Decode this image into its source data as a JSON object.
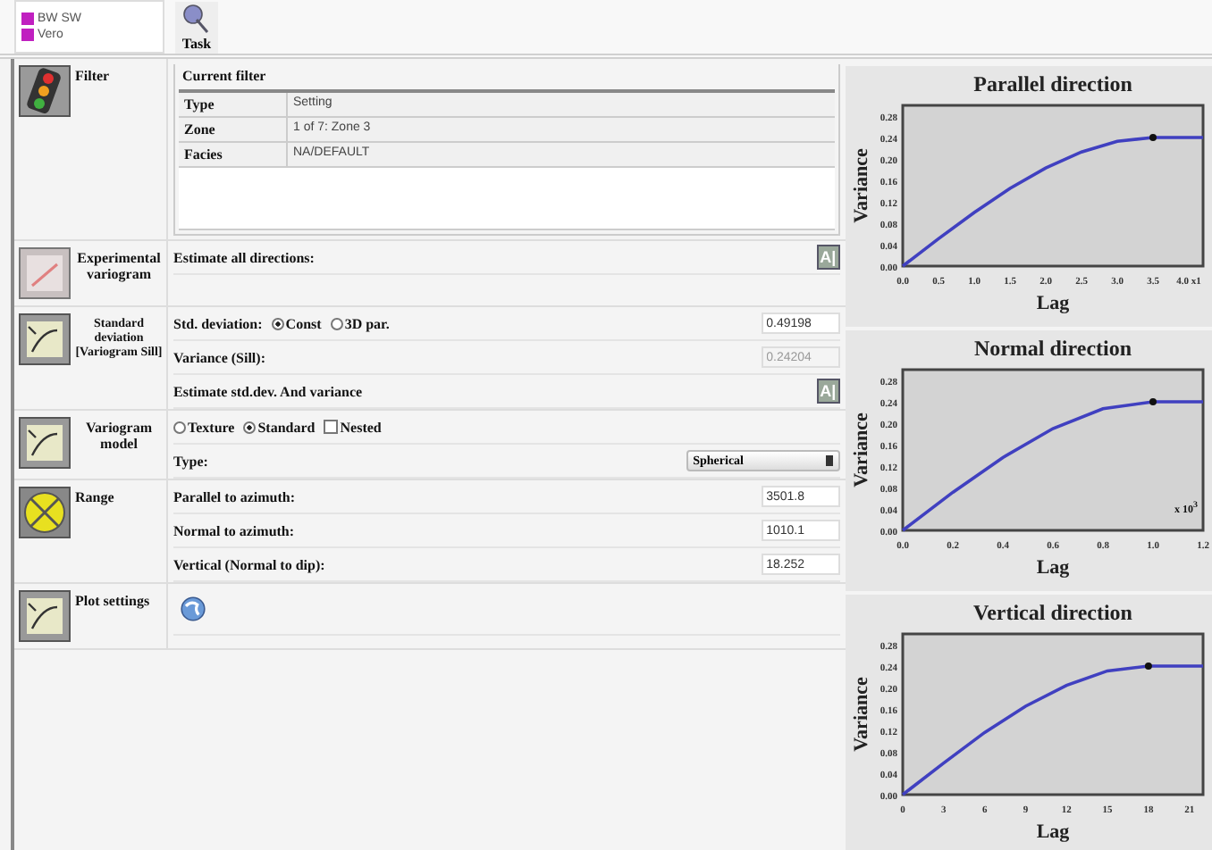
{
  "legend": [
    {
      "label": "BW SW",
      "color": "#c020c0"
    },
    {
      "label": "Vero",
      "color": "#c020c0"
    }
  ],
  "task_button": {
    "label": "Task"
  },
  "filter": {
    "label": "Filter",
    "group_title": "Current filter",
    "rows": [
      {
        "key": "Type",
        "value": "Setting"
      },
      {
        "key": "Zone",
        "value": "1 of 7: Zone 3"
      },
      {
        "key": "Facies",
        "value": "NA/DEFAULT"
      }
    ]
  },
  "experimental_variogram": {
    "label": "Experimental variogram",
    "text": "Estimate all directions:",
    "button": "A|"
  },
  "standard_deviation": {
    "label": "Standard deviation [Variogram Sill]",
    "std_label": "Std. deviation:",
    "options": [
      {
        "label": "Const",
        "selected": true
      },
      {
        "label": "3D par.",
        "selected": false
      }
    ],
    "std_value": "0.49198",
    "variance_label": "Variance (Sill):",
    "variance_value": "0.24204",
    "variance_disabled": true,
    "estimate_text": "Estimate std.dev. And variance",
    "button": "A|"
  },
  "variogram_model": {
    "label": "Variogram model",
    "options": [
      {
        "kind": "radio",
        "label": "Texture",
        "selected": false
      },
      {
        "kind": "radio",
        "label": "Standard",
        "selected": true
      },
      {
        "kind": "checkbox",
        "label": "Nested",
        "checked": false
      }
    ],
    "type_label": "Type:",
    "type_value": "Spherical"
  },
  "range": {
    "label": "Range",
    "rows": [
      {
        "label": "Parallel to azimuth:",
        "value": "3501.8"
      },
      {
        "label": "Normal to azimuth:",
        "value": "1010.1"
      },
      {
        "label": "Vertical (Normal to dip):",
        "value": "18.252"
      }
    ]
  },
  "plot_settings": {
    "label": "Plot settings"
  },
  "charts": [
    {
      "chart_data": {
        "type": "line",
        "title": "Parallel direction",
        "xlabel": "Lag",
        "ylabel": "Variance",
        "x": [
          0,
          0.5,
          1.0,
          1.5,
          2.0,
          2.5,
          3.0,
          3.5,
          4.0,
          4.2
        ],
        "series": [
          {
            "color": "#4040c0",
            "values": [
              0,
              0.051,
              0.1,
              0.145,
              0.183,
              0.213,
              0.233,
              0.24,
              0.24,
              0.24
            ]
          }
        ],
        "xlim": [
          0,
          4.2
        ],
        "ylim": [
          0,
          0.3
        ],
        "xticks": [
          {
            "value": 0,
            "label": "0.0"
          },
          {
            "value": 0.5,
            "label": "0.5"
          },
          {
            "value": 1,
            "label": "1.0"
          },
          {
            "value": 1.5,
            "label": "1.5"
          },
          {
            "value": 2,
            "label": "2.0"
          },
          {
            "value": 2.5,
            "label": "2.5"
          },
          {
            "value": 3,
            "label": "3.0"
          },
          {
            "value": 3.5,
            "label": "3.5"
          },
          {
            "value": 4,
            "label": "4.0 x1"
          }
        ],
        "yticks": [
          {
            "value": 0,
            "label": "0.00"
          },
          {
            "value": 0.04,
            "label": "0.04"
          },
          {
            "value": 0.08,
            "label": "0.08"
          },
          {
            "value": 0.12,
            "label": "0.12"
          },
          {
            "value": 0.16,
            "label": "0.16"
          },
          {
            "value": 0.2,
            "label": "0.20"
          },
          {
            "value": 0.24,
            "label": "0.24"
          },
          {
            "value": 0.28,
            "label": "0.28"
          }
        ]
      }
    },
    {
      "chart_data": {
        "type": "line",
        "title": "Normal direction",
        "xlabel": "Lag",
        "ylabel": "Variance",
        "x": [
          0,
          0.2,
          0.4,
          0.6,
          0.8,
          1.0,
          1.2
        ],
        "series": [
          {
            "color": "#4040c0",
            "values": [
              0,
              0.071,
              0.136,
              0.19,
              0.227,
              0.24,
              0.24
            ]
          }
        ],
        "xlim": [
          0,
          1.2
        ],
        "ylim": [
          0,
          0.3
        ],
        "xticks": [
          {
            "value": 0,
            "label": "0.0"
          },
          {
            "value": 0.2,
            "label": "0.2"
          },
          {
            "value": 0.4,
            "label": "0.4"
          },
          {
            "value": 0.6,
            "label": "0.6"
          },
          {
            "value": 0.8,
            "label": "0.8"
          },
          {
            "value": 1,
            "label": "1.0"
          },
          {
            "value": 1.2,
            "label": "1.2"
          }
        ],
        "yticks": [
          {
            "value": 0,
            "label": "0.00"
          },
          {
            "value": 0.04,
            "label": "0.04"
          },
          {
            "value": 0.08,
            "label": "0.08"
          },
          {
            "value": 0.12,
            "label": "0.12"
          },
          {
            "value": 0.16,
            "label": "0.16"
          },
          {
            "value": 0.2,
            "label": "0.20"
          },
          {
            "value": 0.24,
            "label": "0.24"
          },
          {
            "value": 0.28,
            "label": "0.28"
          }
        ],
        "annotations": [
          {
            "text": "x 10$^{3}$"
          }
        ]
      }
    },
    {
      "chart_data": {
        "type": "line",
        "title": "Vertical direction",
        "xlabel": "Lag",
        "ylabel": "Variance",
        "x": [
          0,
          3,
          6,
          9,
          12,
          15,
          18,
          21,
          22
        ],
        "series": [
          {
            "color": "#4040c0",
            "values": [
              0,
              0.059,
              0.116,
              0.165,
              0.204,
              0.231,
              0.24,
              0.24,
              0.24
            ]
          }
        ],
        "xlim": [
          0,
          22
        ],
        "ylim": [
          0,
          0.3
        ],
        "xticks": [
          0,
          3,
          6,
          9,
          12,
          15,
          18,
          21
        ],
        "yticks": [
          {
            "value": 0,
            "label": "0.00"
          },
          {
            "value": 0.04,
            "label": "0.04"
          },
          {
            "value": 0.08,
            "label": "0.08"
          },
          {
            "value": 0.12,
            "label": "0.12"
          },
          {
            "value": 0.16,
            "label": "0.16"
          },
          {
            "value": 0.2,
            "label": "0.20"
          },
          {
            "value": 0.24,
            "label": "0.24"
          },
          {
            "value": 0.28,
            "label": "0.28"
          }
        ]
      }
    }
  ]
}
